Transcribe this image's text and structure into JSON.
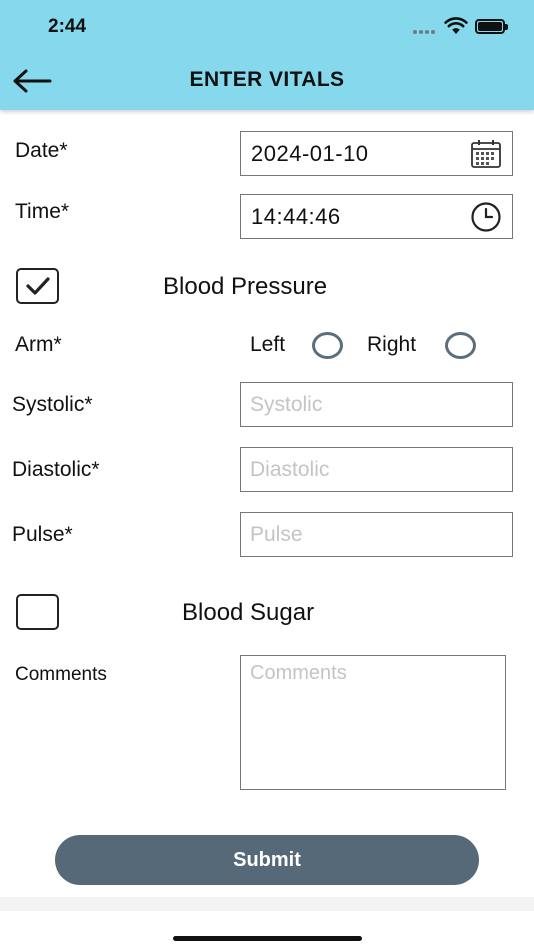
{
  "status_bar": {
    "time": "2:44"
  },
  "header": {
    "title": "ENTER VITALS"
  },
  "date": {
    "label": "Date*",
    "value": "2024-01-10"
  },
  "time": {
    "label": "Time*",
    "value": "14:44:46"
  },
  "blood_pressure": {
    "title": "Blood Pressure",
    "checked": true,
    "arm_label": "Arm*",
    "left_label": "Left",
    "right_label": "Right",
    "systolic": {
      "label": "Systolic*",
      "placeholder": "Systolic",
      "value": ""
    },
    "diastolic": {
      "label": "Diastolic*",
      "placeholder": "Diastolic",
      "value": ""
    },
    "pulse": {
      "label": "Pulse*",
      "placeholder": "Pulse",
      "value": ""
    }
  },
  "blood_sugar": {
    "title": "Blood Sugar",
    "checked": false
  },
  "comments": {
    "label": "Comments",
    "placeholder": "Comments",
    "value": ""
  },
  "submit_label": "Submit",
  "icons": {
    "back": "arrow-left-icon",
    "calendar": "calendar-icon",
    "clock": "clock-icon",
    "wifi": "wifi-icon",
    "battery": "battery-icon",
    "check": "checkmark-icon"
  },
  "colors": {
    "header_bg": "#86d8ec",
    "button_bg": "#566979",
    "radio_border": "#5a6e7c"
  }
}
